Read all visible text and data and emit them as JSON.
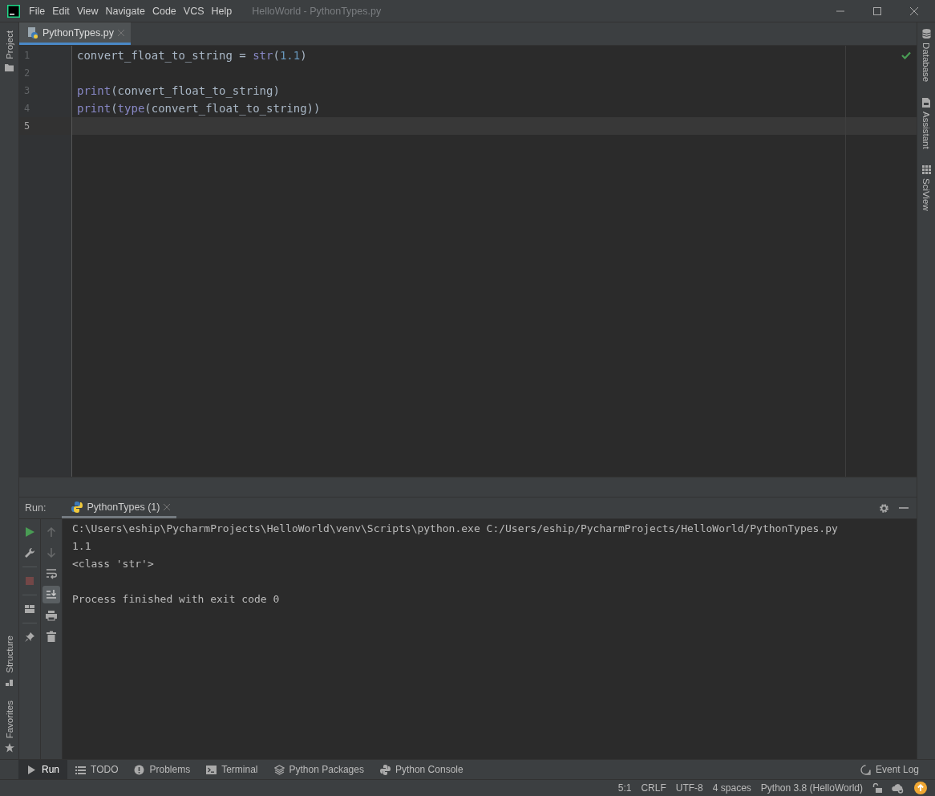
{
  "title_bar": {
    "menu": [
      "File",
      "Edit",
      "View",
      "Navigate",
      "Code",
      "VCS",
      "Help"
    ],
    "title": "HelloWorld - PythonTypes.py"
  },
  "left_strip_top": [
    "Project"
  ],
  "left_strip_bottom": [
    "Structure",
    "Favorites"
  ],
  "right_strip": [
    "Database",
    "Assistant",
    "SciView"
  ],
  "editor": {
    "tabs": [
      {
        "label": "PythonTypes.py",
        "selected": true
      }
    ],
    "lines": [
      {
        "number": "1",
        "current": false,
        "tokens": [
          {
            "text": "convert_float_to_string = ",
            "kind": "plain"
          },
          {
            "text": "str",
            "kind": "builtin"
          },
          {
            "text": "(",
            "kind": "plain"
          },
          {
            "text": "1.1",
            "kind": "number"
          },
          {
            "text": ")",
            "kind": "plain"
          }
        ]
      },
      {
        "number": "2",
        "current": false
      },
      {
        "number": "3",
        "current": false,
        "tokens": [
          {
            "text": "print",
            "kind": "builtin"
          },
          {
            "text": "(convert_float_to_string)",
            "kind": "plain"
          }
        ]
      },
      {
        "number": "4",
        "current": false,
        "tokens": [
          {
            "text": "print",
            "kind": "builtin"
          },
          {
            "text": "(",
            "kind": "plain"
          },
          {
            "text": "type",
            "kind": "builtin"
          },
          {
            "text": "(convert_float_to_string))",
            "kind": "plain"
          }
        ]
      },
      {
        "number": "5",
        "current": true
      }
    ]
  },
  "run_panel": {
    "label": "Run:",
    "tabs": [
      {
        "label": "PythonTypes (1)",
        "selected": true
      }
    ],
    "toolbar_left": [
      {
        "kind": "run",
        "disabled": false
      },
      {
        "kind": "wrench",
        "disabled": false
      },
      {
        "kind": "stop",
        "disabled": true
      },
      {
        "kind": "layout",
        "disabled": false
      },
      {
        "kind": "pin",
        "disabled": false
      }
    ],
    "toolbar_right": [
      {
        "kind": "up",
        "disabled": true,
        "on": false
      },
      {
        "kind": "down",
        "disabled": true,
        "on": false
      },
      {
        "kind": "wrap",
        "disabled": false,
        "on": false
      },
      {
        "kind": "scroll-end",
        "disabled": false,
        "on": true
      },
      {
        "kind": "print",
        "disabled": false,
        "on": false
      },
      {
        "kind": "trash",
        "disabled": false,
        "on": false
      }
    ],
    "output_groups": [
      [
        "C:\\Users\\eship\\PycharmProjects\\HelloWorld\\venv\\Scripts\\python.exe C:/Users/eship/PycharmProjects/HelloWorld/PythonTypes.py",
        "1.1",
        "<class 'str'>"
      ],
      [
        "Process finished with exit code 0"
      ]
    ]
  },
  "tool_tabs": [
    {
      "label": "Run",
      "kind": "run",
      "selected": true
    },
    {
      "label": "TODO",
      "kind": "list",
      "selected": false
    },
    {
      "label": "Problems",
      "kind": "problems",
      "selected": false
    },
    {
      "label": "Terminal",
      "kind": "terminal",
      "selected": false
    },
    {
      "label": "Python Packages",
      "kind": "layers",
      "selected": false
    },
    {
      "label": "Python Console",
      "kind": "python",
      "selected": false
    }
  ],
  "event_log": "Event Log",
  "status_bar": [
    "5:1",
    "CRLF",
    "UTF-8",
    "4 spaces",
    "Python 3.8 (HelloWorld)"
  ]
}
